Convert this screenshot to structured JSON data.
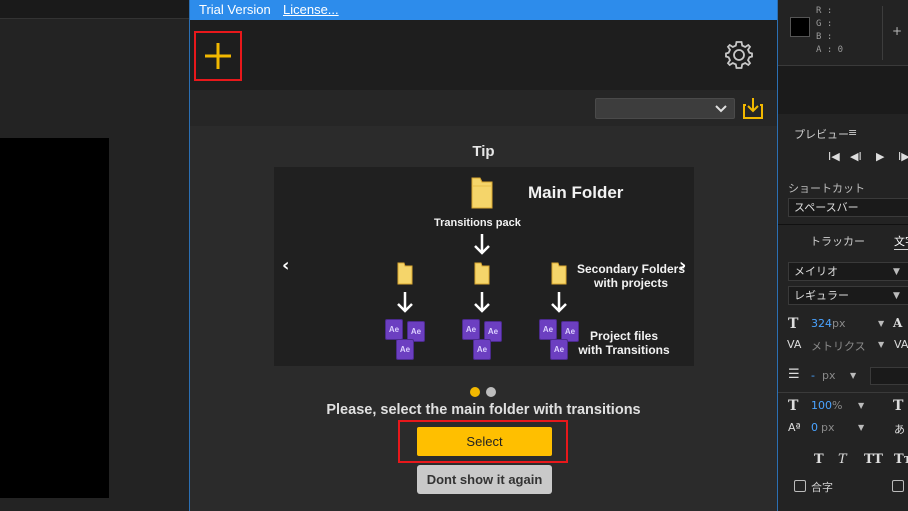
{
  "plugin": {
    "topbar": {
      "trial": "Trial Version",
      "license": "License..."
    },
    "tip_title": "Tip",
    "card": {
      "main_folder": "Main Folder",
      "transitions_pack": "Transitions pack",
      "secondary_line1": "Secondary Folders",
      "secondary_line2": "with projects",
      "project_line1": "Project files",
      "project_line2": "with Transitions",
      "nav_prev": "‹",
      "nav_next": "›",
      "ae_label": "Ae"
    },
    "carousel": {
      "total": 2,
      "active": 1
    },
    "instruction": "Please, select the main folder with transitions",
    "select_label": "Select",
    "dont_show_label": "Dont show it again",
    "icons": [
      "plus-icon",
      "gear-icon",
      "chevron-down-icon",
      "import-icon",
      "folder-icon",
      "arrow-down-icon"
    ]
  },
  "right_panel": {
    "info": {
      "r": "R :",
      "g": "G :",
      "b": "B :",
      "a": "A : 0",
      "plus": "+"
    },
    "preview_title": "プレビュー",
    "menu": "≡",
    "playback": [
      "I◀",
      "◀I",
      "▶",
      "I▶"
    ],
    "shortcut_label": "ショートカット",
    "shortcut_value": "スペースバー",
    "tabs": {
      "tracker": "トラッカー",
      "character": "文字"
    },
    "font_family": "メイリオ",
    "font_style": "レギュラー",
    "font_size": "324",
    "font_size_unit": "px",
    "kerning": "メトリクス",
    "stroke_value": "-",
    "stroke_unit": "px",
    "vscale": "100",
    "vscale_unit": "%",
    "baseline": "0",
    "baseline_unit": "px",
    "style_buttons": [
      "T",
      "T",
      "TT",
      "Tт"
    ],
    "ligature": "合字",
    "colors": {
      "accent_blue": "#2d8ceb",
      "select_yellow": "#ffbf00",
      "highlight_red": "#e8181b"
    }
  }
}
